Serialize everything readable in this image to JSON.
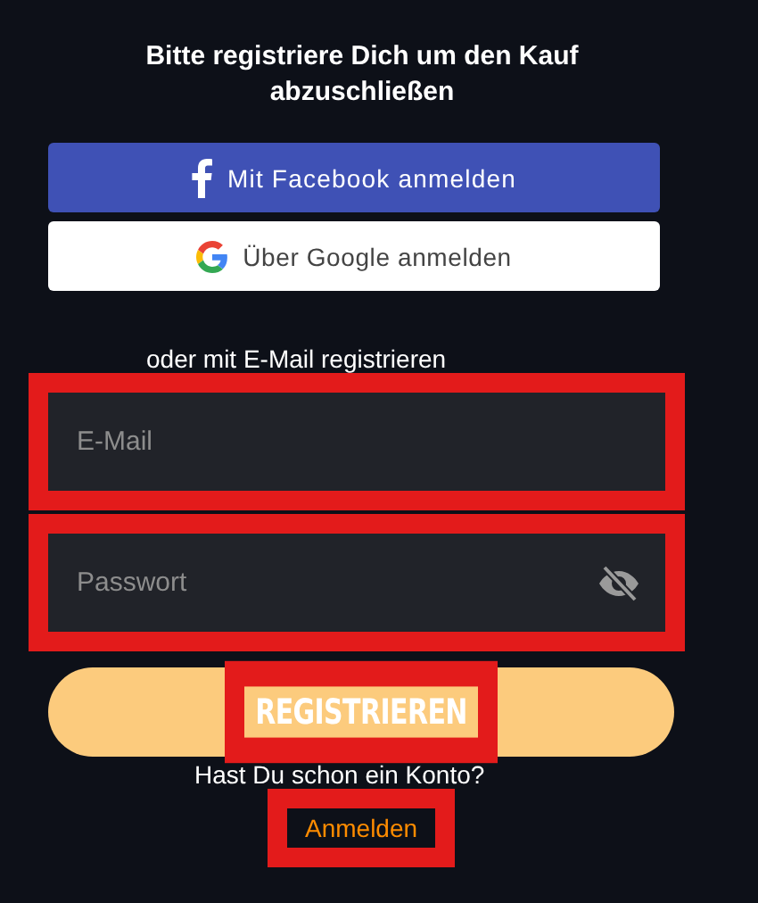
{
  "title": "Bitte registriere Dich um den Kauf abzuschließen",
  "social_buttons": [
    {
      "kind": "facebook",
      "label": "Mit Facebook anmelden"
    },
    {
      "kind": "google",
      "label": "Über Google anmelden"
    }
  ],
  "divider_text": "oder mit E-Mail registrieren",
  "fields": [
    {
      "kind": "email",
      "placeholder": "E-Mail",
      "highlighted": true
    },
    {
      "kind": "password",
      "placeholder": "Passwort",
      "highlighted": true
    }
  ],
  "submit": {
    "label": "REGISTRIEREN",
    "highlighted": true
  },
  "account_prompt": "Hast Du schon ein Konto?",
  "login_link": {
    "label": "Anmelden",
    "highlighted": true
  }
}
